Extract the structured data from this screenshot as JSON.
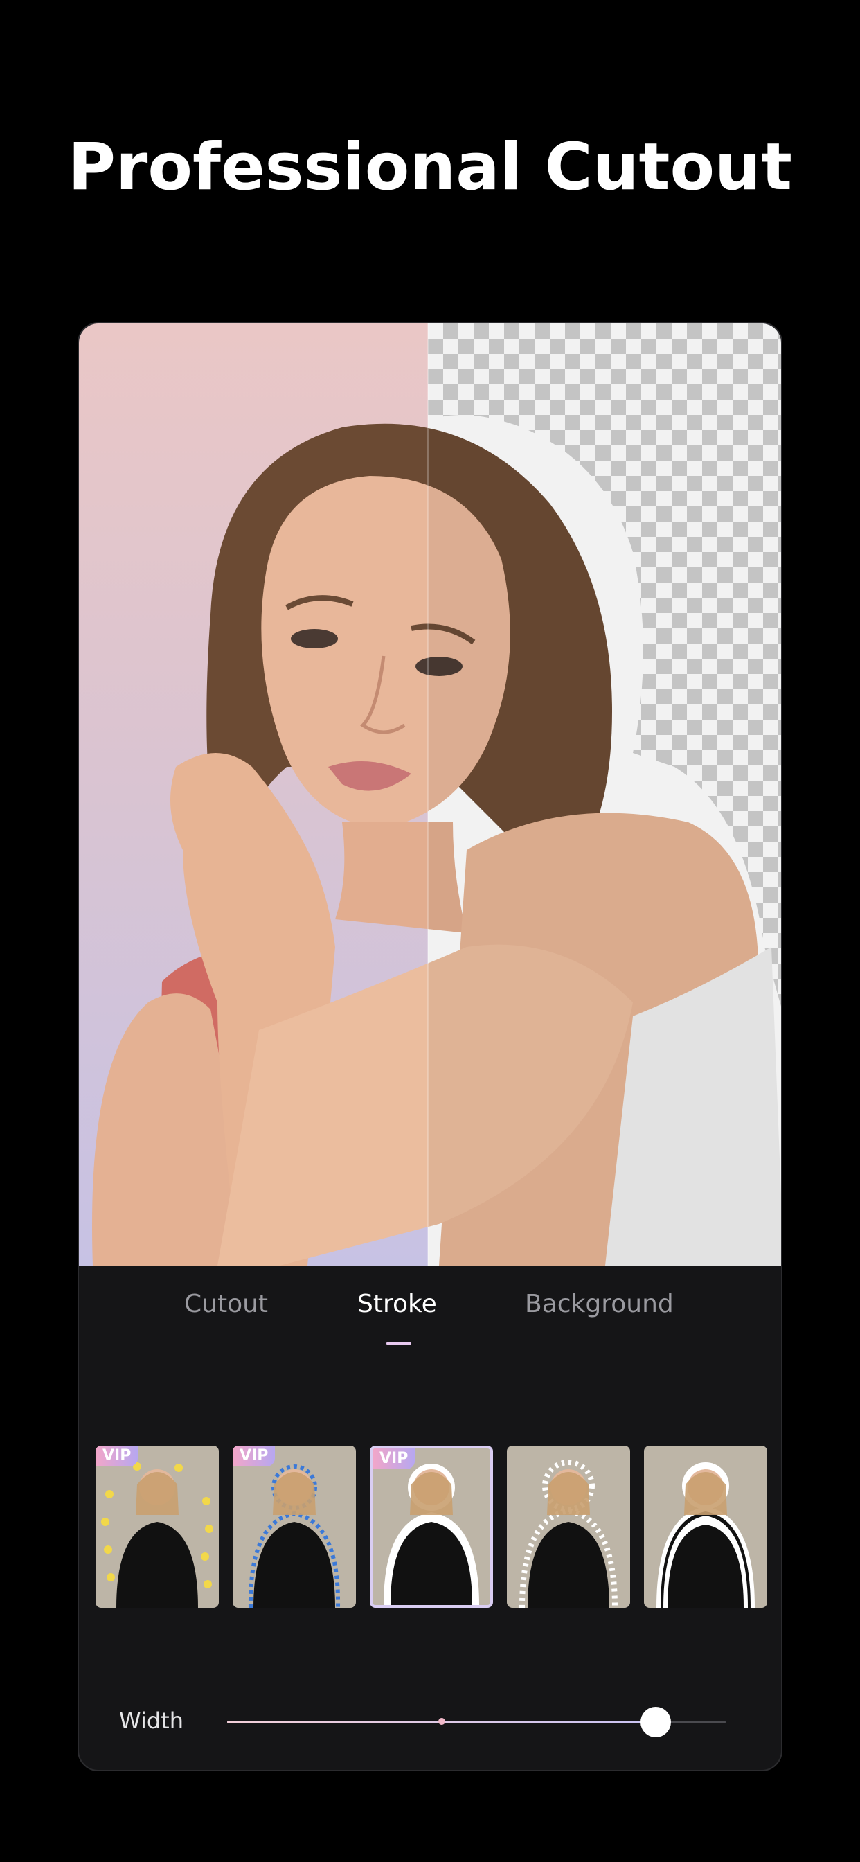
{
  "headline": "Professional Cutout",
  "tabs": [
    {
      "label": "Cutout"
    },
    {
      "label": "Stroke"
    },
    {
      "label": "Background"
    }
  ],
  "active_tab": "Stroke",
  "stroke_presets": [
    {
      "style": "sticker-dots",
      "badge": "VIP"
    },
    {
      "style": "blue-dotted",
      "badge": "VIP"
    },
    {
      "style": "solid-white",
      "badge": "VIP"
    },
    {
      "style": "white-dotted",
      "badge": ""
    },
    {
      "style": "double-white",
      "badge": ""
    }
  ],
  "selected_preset_index": 2,
  "width_control": {
    "label": "Width",
    "value_fraction": 0.86
  },
  "colors": {
    "accent": "#e8c9f0",
    "panel": "#151517",
    "page": "#000000"
  }
}
